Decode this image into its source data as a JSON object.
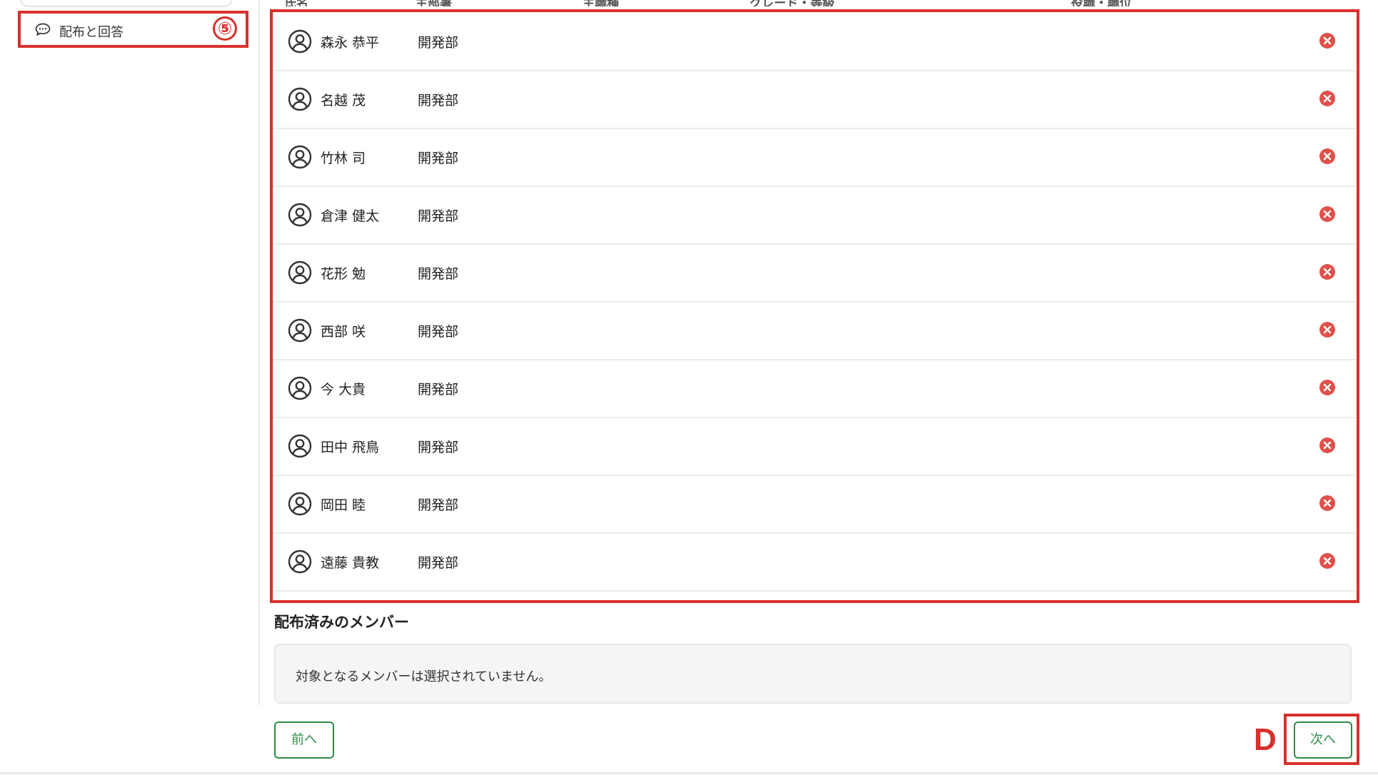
{
  "sidebar": {
    "item_label": "配布と回答",
    "marker": "⑤"
  },
  "table": {
    "headers": [
      "氏名",
      "主部署",
      "主職種",
      "グレード・等級",
      "役職・職位"
    ],
    "rows": [
      {
        "name": "森永 恭平",
        "dept": "開発部"
      },
      {
        "name": "名越 茂",
        "dept": "開発部"
      },
      {
        "name": "竹林 司",
        "dept": "開発部"
      },
      {
        "name": "倉津 健太",
        "dept": "開発部"
      },
      {
        "name": "花形 勉",
        "dept": "開発部"
      },
      {
        "name": "西部 咲",
        "dept": "開発部"
      },
      {
        "name": "今 大貴",
        "dept": "開発部"
      },
      {
        "name": "田中 飛鳥",
        "dept": "開発部"
      },
      {
        "name": "岡田 睦",
        "dept": "開発部"
      },
      {
        "name": "遠藤 貴教",
        "dept": "開発部"
      }
    ]
  },
  "distributed": {
    "title": "配布済みのメンバー",
    "empty_message": "対象となるメンバーは選択されていません。"
  },
  "footer": {
    "prev_label": "前へ",
    "next_label": "次へ",
    "marker": "D"
  },
  "colors": {
    "annotation_red": "#d8302b",
    "primary_green": "#2f8a47",
    "remove_red": "#e0514b"
  },
  "icons": {
    "row_avatar": "user-circle-icon",
    "row_remove": "remove-circle-x-icon",
    "sidebar_item": "chat-bubble-icon"
  }
}
